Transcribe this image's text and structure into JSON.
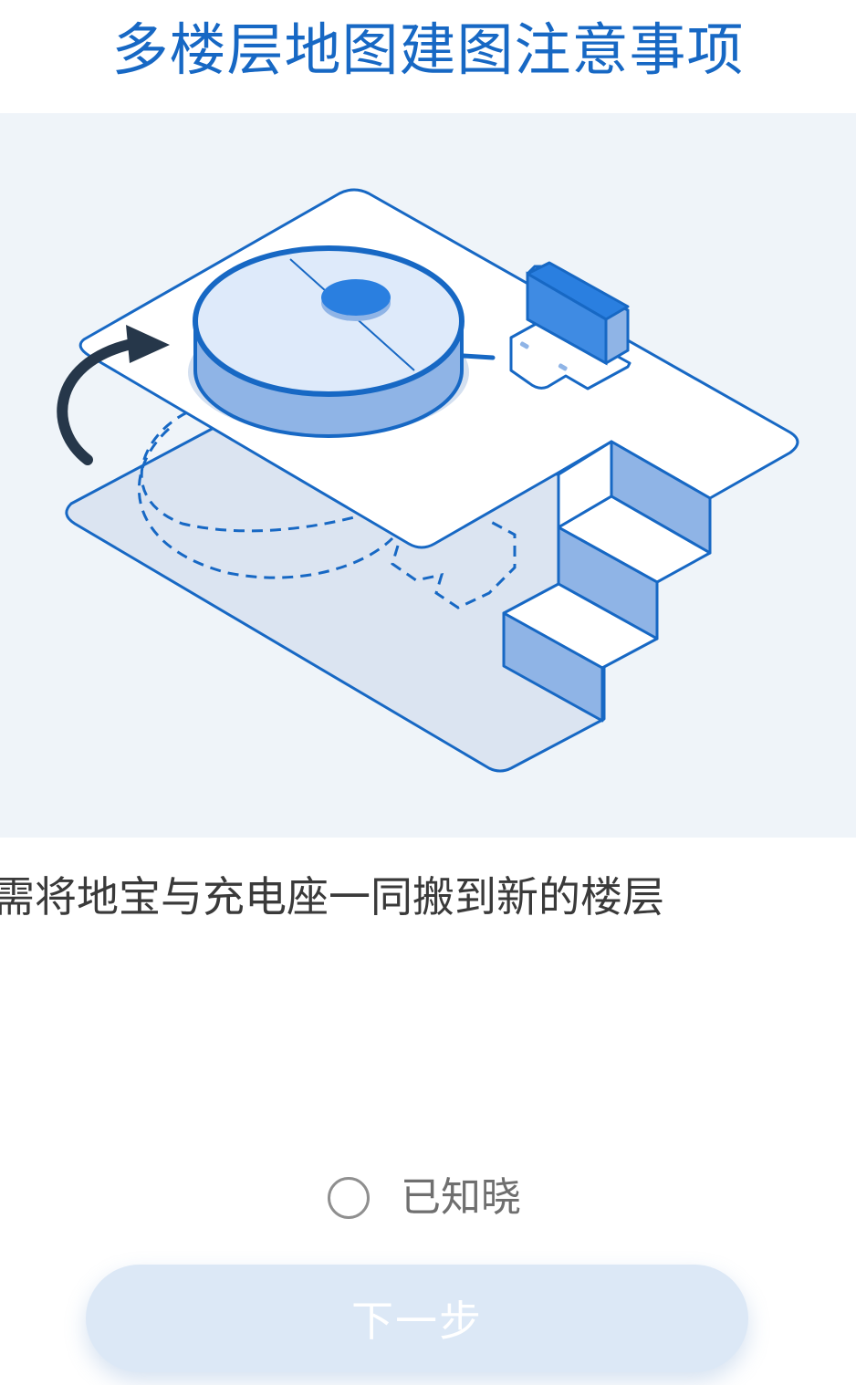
{
  "header": {
    "title": "多楼层地图建图注意事项"
  },
  "illustration": {
    "icon": "robot-vacuum-multi-floor-illustration",
    "colors": {
      "background": "#eff4f9",
      "stroke": "#1768c4",
      "fill_light": "#dbe4f1",
      "fill_mid": "#8fb4e6",
      "accent": "#2a7fe0",
      "arrow": "#26374a"
    }
  },
  "body": {
    "tip": "需将地宝与充电座一同搬到新的楼层"
  },
  "acknowledge": {
    "label": "已知晓",
    "checked": false
  },
  "footer": {
    "next_label": "下一步",
    "enabled": false
  },
  "colors": {
    "title": "#1768c4",
    "button_disabled": "#dce8f6"
  }
}
